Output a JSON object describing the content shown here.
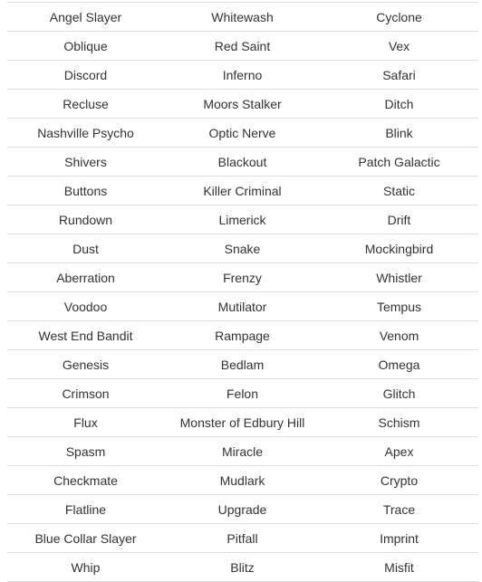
{
  "colors": {
    "text": "#333333",
    "border": "#dddddd",
    "background": "#ffffff"
  },
  "table": {
    "rows": [
      [
        "Angel Slayer",
        "Whitewash",
        "Cyclone"
      ],
      [
        "Oblique",
        "Red Saint",
        "Vex"
      ],
      [
        "Discord",
        "Inferno",
        "Safari"
      ],
      [
        "Recluse",
        "Moors Stalker",
        "Ditch"
      ],
      [
        "Nashville Psycho",
        "Optic Nerve",
        "Blink"
      ],
      [
        "Shivers",
        "Blackout",
        "Patch Galactic"
      ],
      [
        "Buttons",
        "Killer Criminal",
        "Static"
      ],
      [
        "Rundown",
        "Limerick",
        "Drift"
      ],
      [
        "Dust",
        "Snake",
        "Mockingbird"
      ],
      [
        "Aberration",
        "Frenzy",
        "Whistler"
      ],
      [
        "Voodoo",
        "Mutilator",
        "Tempus"
      ],
      [
        "West End Bandit",
        "Rampage",
        "Venom"
      ],
      [
        "Genesis",
        "Bedlam",
        "Omega"
      ],
      [
        "Crimson",
        "Felon",
        "Glitch"
      ],
      [
        "Flux",
        "Monster of Edbury Hill",
        "Schism"
      ],
      [
        "Spasm",
        "Miracle",
        "Apex"
      ],
      [
        "Checkmate",
        "Mudlark",
        "Crypto"
      ],
      [
        "Flatline",
        "Upgrade",
        "Trace"
      ],
      [
        "Blue Collar Slayer",
        "Pitfall",
        "Imprint"
      ],
      [
        "Whip",
        "Blitz",
        "Misfit"
      ]
    ]
  }
}
